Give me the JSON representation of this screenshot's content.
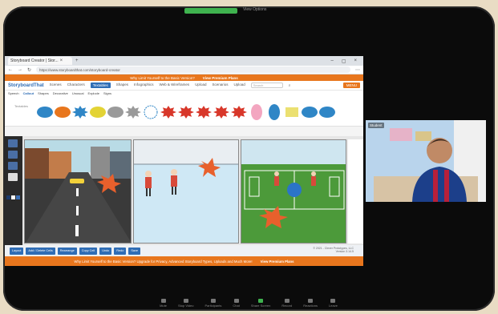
{
  "zoom_top": {
    "label": "View Options"
  },
  "browser": {
    "tab_title": "Storyboard Creator | Stor...",
    "url": "https://www.storyboardthat.com/storyboard-creator",
    "banner_text": "Why Limit Yourself to the Basic Version?",
    "banner_upgrade": "View Premium Plans"
  },
  "nav": {
    "logo": "StoryboardThat",
    "items": [
      "Scenes",
      "Characters",
      "Textables",
      "Shapes",
      "Infographics",
      "Web & Wireframes",
      "Upload",
      "Scenarios",
      "Upload"
    ],
    "active_index": 2,
    "search_placeholder": "Search",
    "menu": "MENU"
  },
  "subnav": {
    "items": [
      "Speech",
      "Callout",
      "Shapes",
      "Decorative",
      "Unusual",
      "Explode",
      "Signs"
    ],
    "active_index": 1
  },
  "palette": {
    "label": "Textables",
    "shapes": [
      "blob-blue",
      "blob-orange",
      "burst-blue",
      "blob-yellow",
      "cloud-gray",
      "starburst-gray",
      "circle-dashed",
      "pow-red",
      "wham-red",
      "bang-red",
      "boom-red",
      "splat-red",
      "oval-pink",
      "oval-blue",
      "lines-yellow",
      "splash-blue",
      "ribbon-blue"
    ]
  },
  "bottom_toolbar": {
    "buttons": [
      "Layout",
      "Add / Delete Cells",
      "Rearrange",
      "Copy Cell",
      "Undo",
      "Redo",
      "Save"
    ],
    "copyright_line1": "© 2021 - Clever Prototypes, LLC",
    "copyright_line2": "Version 3.14.5"
  },
  "bottom_strip": {
    "text": "Why Limit Yourself to the Basic Version? Upgrade for Privacy, Advanced Storyboard Types, Uploads and Much More!",
    "link": "View Premium Plans"
  },
  "webcam": {
    "name": "Student"
  },
  "zoom_controls": [
    "Mute",
    "Stop Video",
    "Participants",
    "Chat",
    "Share Screen",
    "Record",
    "Reactions",
    "Leave"
  ]
}
